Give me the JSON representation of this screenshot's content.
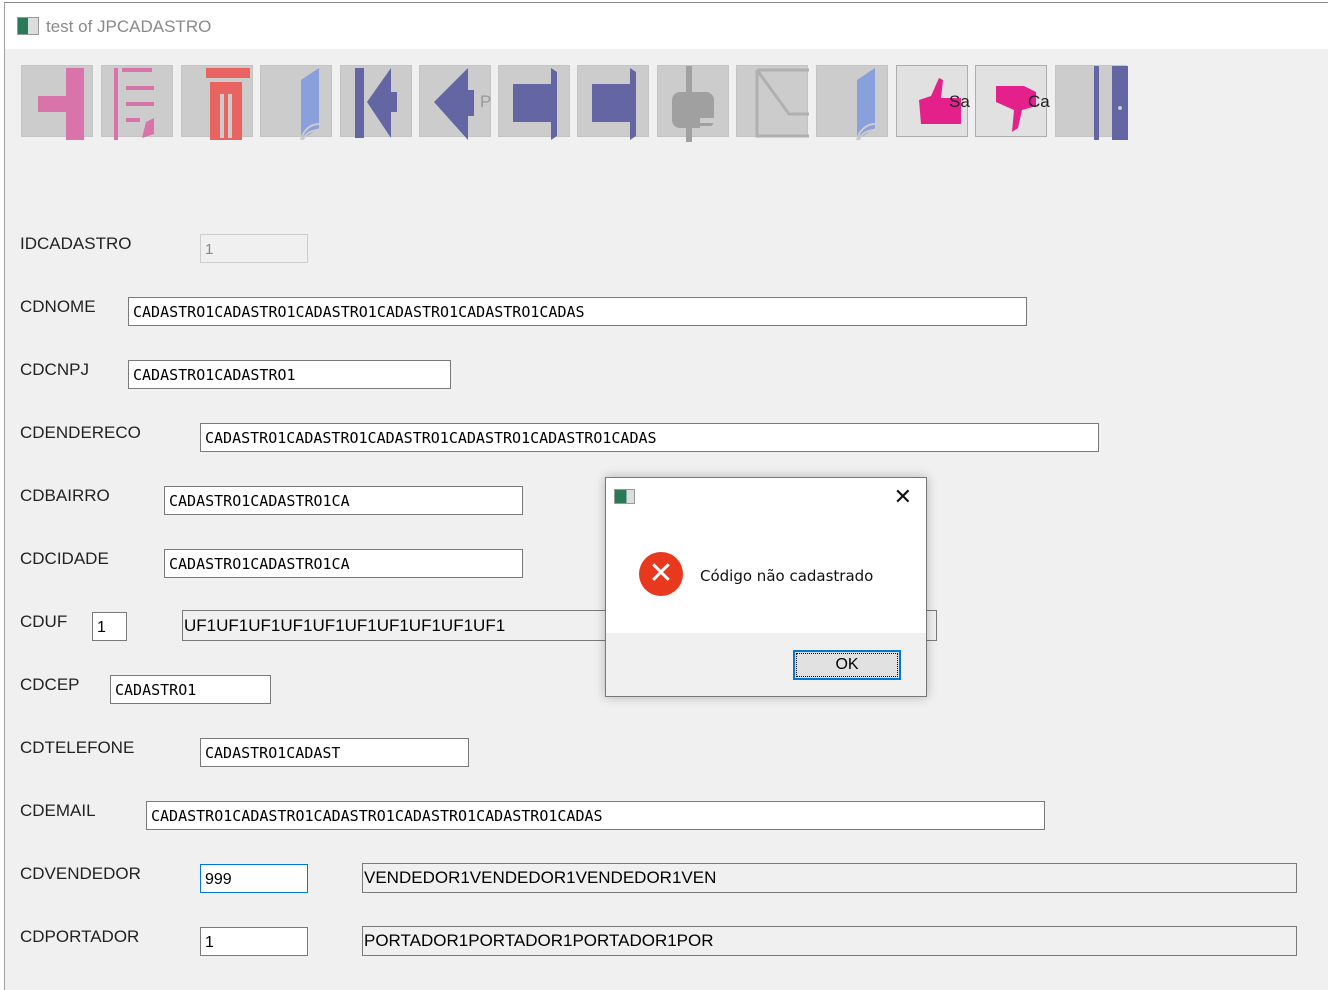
{
  "window": {
    "title": "test of JPCADASTRO"
  },
  "toolbar": {
    "buttons": [
      {
        "name": "new",
        "icon": "plus-icon",
        "color": "#d874a9"
      },
      {
        "name": "edit",
        "icon": "edit-icon",
        "color": "#d874a9"
      },
      {
        "name": "delete",
        "icon": "trash-icon",
        "color": "#e96461"
      },
      {
        "name": "book",
        "icon": "book-icon",
        "color": "#8aa0dc"
      },
      {
        "name": "first",
        "icon": "first-icon",
        "color": "#6466a4"
      },
      {
        "name": "previous",
        "icon": "previous-icon",
        "color": "#6466a4",
        "caption": "P"
      },
      {
        "name": "next",
        "icon": "next-icon",
        "color": "#6466a4"
      },
      {
        "name": "last",
        "icon": "last-icon",
        "color": "#6466a4"
      },
      {
        "name": "print",
        "icon": "print-icon",
        "color": "#a0a0a0"
      },
      {
        "name": "email",
        "icon": "envelope-icon",
        "color": "#b0b0b0"
      },
      {
        "name": "help",
        "icon": "book-icon",
        "color": "#8aa0dc"
      },
      {
        "name": "save",
        "icon": "thumbs-up-icon",
        "color": "#e4208a",
        "caption": "Sa"
      },
      {
        "name": "cancel",
        "icon": "thumbs-down-icon",
        "color": "#e4208a",
        "caption": "Ca"
      },
      {
        "name": "exit",
        "icon": "door-icon",
        "color": "#6466a4"
      }
    ]
  },
  "form": {
    "idcadastro": {
      "label": "IDCADASTRO",
      "value": "1"
    },
    "cdnome": {
      "label": "CDNOME",
      "value": "CADASTRO1CADASTRO1CADASTRO1CADASTRO1CADASTRO1CADAS"
    },
    "cdcnpj": {
      "label": "CDCNPJ",
      "value": "CADASTRO1CADASTRO1"
    },
    "cdendereco": {
      "label": "CDENDERECO",
      "value": "CADASTRO1CADASTRO1CADASTRO1CADASTRO1CADASTRO1CADAS"
    },
    "cdbairro": {
      "label": "CDBAIRRO",
      "value": "CADASTRO1CADASTRO1CA"
    },
    "cdcidade": {
      "label": "CDCIDADE",
      "value": "CADASTRO1CADASTRO1CA"
    },
    "cduf": {
      "label": "CDUF",
      "value": "1",
      "description": "UF1UF1UF1UF1UF1UF1UF1UF1UF1UF1"
    },
    "cdcep": {
      "label": "CDCEP",
      "value": "CADASTRO1"
    },
    "cdtelefone": {
      "label": "CDTELEFONE",
      "value": "CADASTRO1CADAST"
    },
    "cdemail": {
      "label": "CDEMAIL",
      "value": "CADASTRO1CADASTRO1CADASTRO1CADASTRO1CADASTRO1CADAS"
    },
    "cdvendedor": {
      "label": "CDVENDEDOR",
      "value": "999",
      "description": "VENDEDOR1VENDEDOR1VENDEDOR1VEN"
    },
    "cdportador": {
      "label": "CDPORTADOR",
      "value": "1",
      "description": "PORTADOR1PORTADOR1PORTADOR1POR"
    }
  },
  "dialog": {
    "message": "Código não cadastrado",
    "ok_label": "OK",
    "close_glyph": "✕",
    "error_glyph": "✕"
  }
}
